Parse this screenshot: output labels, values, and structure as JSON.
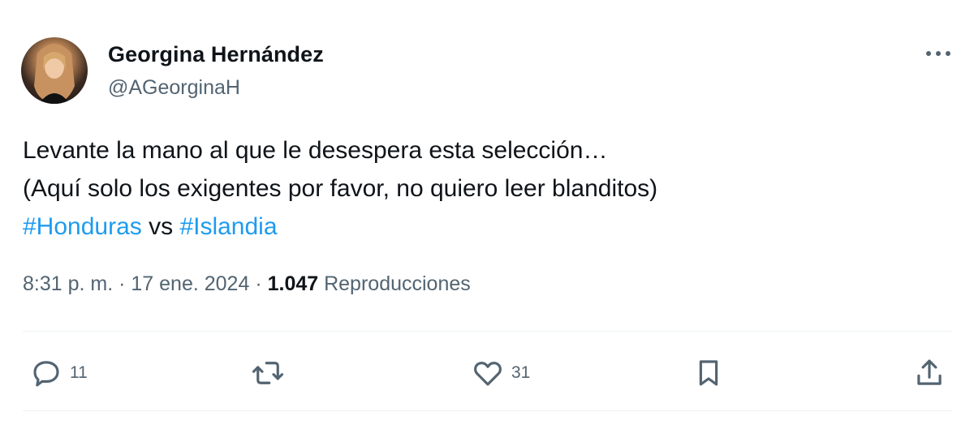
{
  "author": {
    "name": "Georgina Hernández",
    "handle": "@AGeorginaH"
  },
  "tweet": {
    "line1": "Levante la mano al que le desespera esta selección…",
    "line2": "(Aquí solo los exigentes por favor, no quiero leer blanditos)",
    "hashtag1": "#Honduras",
    "vs": " vs ",
    "hashtag2": "#Islandia"
  },
  "meta": {
    "time": "8:31 p. m.",
    "sep1": " · ",
    "date": "17 ene. 2024",
    "sep2": " · ",
    "views": "1.047",
    "views_label": " Reproducciones"
  },
  "actions": {
    "replies": "11",
    "likes": "31"
  },
  "colors": {
    "text": "#0f1419",
    "secondary": "#536471",
    "link": "#1d9bf0",
    "divider": "#eff3f4"
  },
  "icons": [
    "more-icon",
    "reply-icon",
    "retweet-icon",
    "like-icon",
    "bookmark-icon",
    "share-icon"
  ]
}
